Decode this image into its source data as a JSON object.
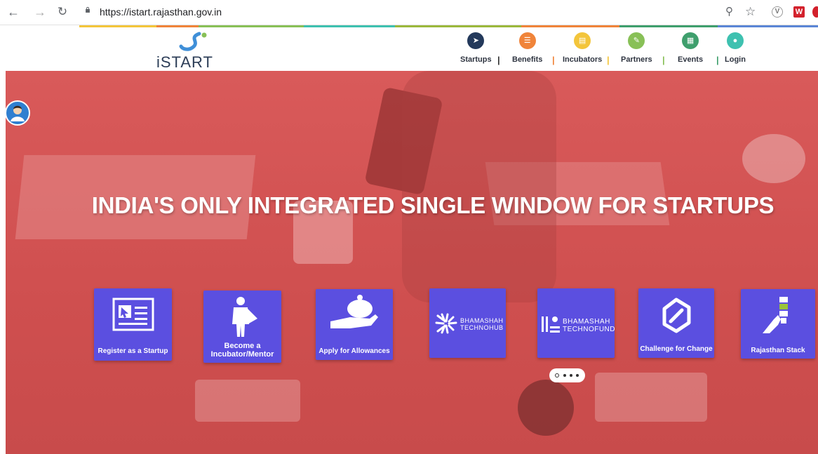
{
  "browser": {
    "url": "https://istart.rajasthan.gov.in",
    "back_icon": "back-arrow-icon",
    "forward_icon": "forward-arrow-icon",
    "reload_icon": "reload-icon",
    "w_ext": "W"
  },
  "site": {
    "logo_text": "iSTART",
    "menu": [
      {
        "label": "Startups",
        "color": "#23395b"
      },
      {
        "label": "Benefits",
        "color": "#f0843a"
      },
      {
        "label": "Incubators",
        "color": "#f3c53b"
      },
      {
        "label": "Partners",
        "color": "#88c057"
      },
      {
        "label": "Events",
        "color": "#3f9f6d"
      },
      {
        "label": "Login",
        "color": "#3ec1b0"
      }
    ]
  },
  "hero": {
    "title": "INDIA'S ONLY INTEGRATED SINGLE WINDOW FOR STARTUPS",
    "tiles": [
      {
        "label": "Register as a Startup"
      },
      {
        "label_line1": "Become a",
        "label_line2": "Incubator/Mentor"
      },
      {
        "label": "Apply for Allowances"
      },
      {
        "brand_line1": "BHAMASHAH",
        "brand_line2": "TECHNOHUB"
      },
      {
        "brand_line1": "BHAMASHAH",
        "brand_line2": "TECHNOFUND"
      },
      {
        "label": "Challenge for Change"
      },
      {
        "label": "Rajasthan Stack"
      }
    ]
  }
}
